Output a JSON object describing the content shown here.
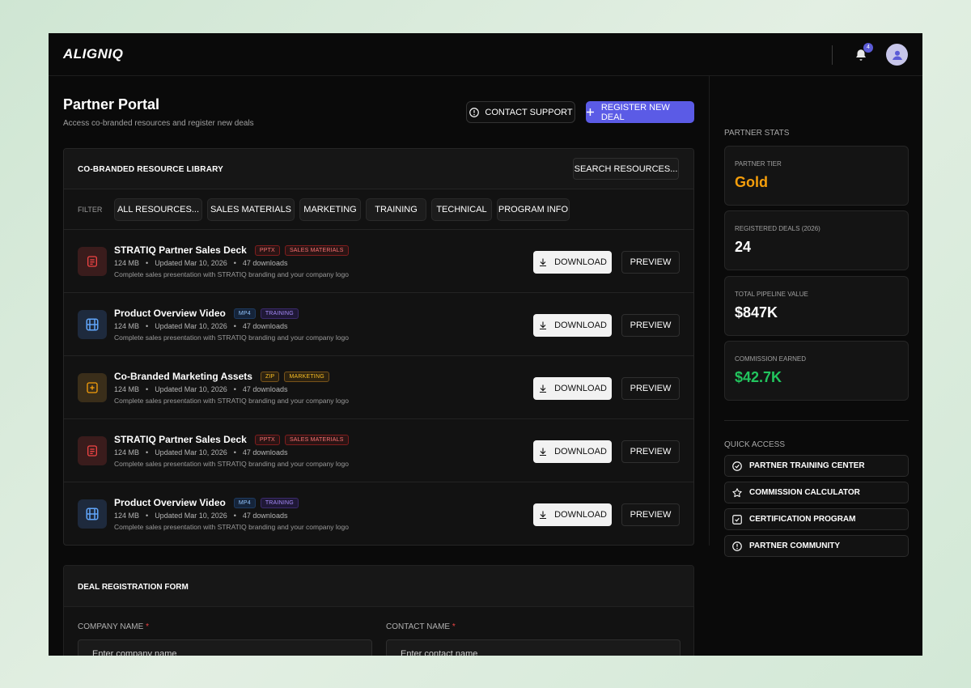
{
  "app": {
    "logo": "ALIGNIQ",
    "notification_count": "4"
  },
  "header": {
    "title": "Partner Portal",
    "subtitle": "Access co-branded resources and register new deals",
    "support_label": "CONTACT SUPPORT",
    "register_label": "REGISTER NEW DEAL"
  },
  "library": {
    "title": "CO-BRANDED RESOURCE LIBRARY",
    "search_label": "SEARCH RESOURCES...",
    "filter_label": "FILTER",
    "filters": [
      "ALL RESOURCES...",
      "SALES MATERIALS",
      "MARKETING",
      "TRAINING",
      "TECHNICAL",
      "PROGRAM INFO"
    ],
    "download_label": "DOWNLOAD",
    "preview_label": "PREVIEW",
    "resources": [
      {
        "title": "STRATIQ Partner Sales Deck",
        "format": "PPTX",
        "category": "SALES MATERIALS",
        "size": "124 MB",
        "updated": "Updated Mar 10, 2026",
        "downloads": "47 downloads",
        "description": "Complete sales presentation with STRATIQ branding and your company logo",
        "icon": "document-icon",
        "color": "#ef4444"
      },
      {
        "title": "Product Overview Video",
        "format": "MP4",
        "category": "TRAINING",
        "size": "124 MB",
        "updated": "Updated Mar 10, 2026",
        "downloads": "47 downloads",
        "description": "Complete sales presentation with STRATIQ branding and your company logo",
        "icon": "film-icon",
        "color": "#60a5fa"
      },
      {
        "title": "Co-Branded Marketing Assets",
        "format": "ZIP",
        "category": "MARKETING",
        "size": "124 MB",
        "updated": "Updated Mar 10, 2026",
        "downloads": "47 downloads",
        "description": "Complete sales presentation with STRATIQ branding and your company logo",
        "icon": "plus-square-icon",
        "color": "#f59e0b"
      },
      {
        "title": "STRATIQ Partner Sales Deck",
        "format": "PPTX",
        "category": "SALES MATERIALS",
        "size": "124 MB",
        "updated": "Updated Mar 10, 2026",
        "downloads": "47 downloads",
        "description": "Complete sales presentation with STRATIQ branding and your company logo",
        "icon": "document-icon",
        "color": "#ef4444"
      },
      {
        "title": "Product Overview Video",
        "format": "MP4",
        "category": "TRAINING",
        "size": "124 MB",
        "updated": "Updated Mar 10, 2026",
        "downloads": "47 downloads",
        "description": "Complete sales presentation with STRATIQ branding and your company logo",
        "icon": "film-icon",
        "color": "#60a5fa"
      }
    ]
  },
  "deal_form": {
    "title": "DEAL REGISTRATION FORM",
    "company_label": "COMPANY NAME",
    "company_placeholder": "Enter company name",
    "contact_label": "CONTACT NAME",
    "contact_placeholder": "Enter contact name",
    "required_mark": "*"
  },
  "sidebar": {
    "stats_title": "PARTNER STATS",
    "stats": [
      {
        "label": "PARTNER TIER",
        "value": "Gold",
        "color": "#f59e0b"
      },
      {
        "label": "REGISTERED DEALS (2026)",
        "value": "24",
        "color": "#ffffff"
      },
      {
        "label": "TOTAL PIPELINE VALUE",
        "value": "$847K",
        "color": "#ffffff"
      },
      {
        "label": "COMMISSION EARNED",
        "value": "$42.7K",
        "color": "#22c55e"
      }
    ],
    "quick_access_title": "QUICK ACCESS",
    "quick_access": [
      {
        "label": "PARTNER TRAINING CENTER",
        "icon": "check-circle-icon"
      },
      {
        "label": "COMMISSION CALCULATOR",
        "icon": "star-icon"
      },
      {
        "label": "CERTIFICATION PROGRAM",
        "icon": "check-square-icon"
      },
      {
        "label": "PARTNER COMMUNITY",
        "icon": "alert-circle-icon"
      }
    ]
  }
}
